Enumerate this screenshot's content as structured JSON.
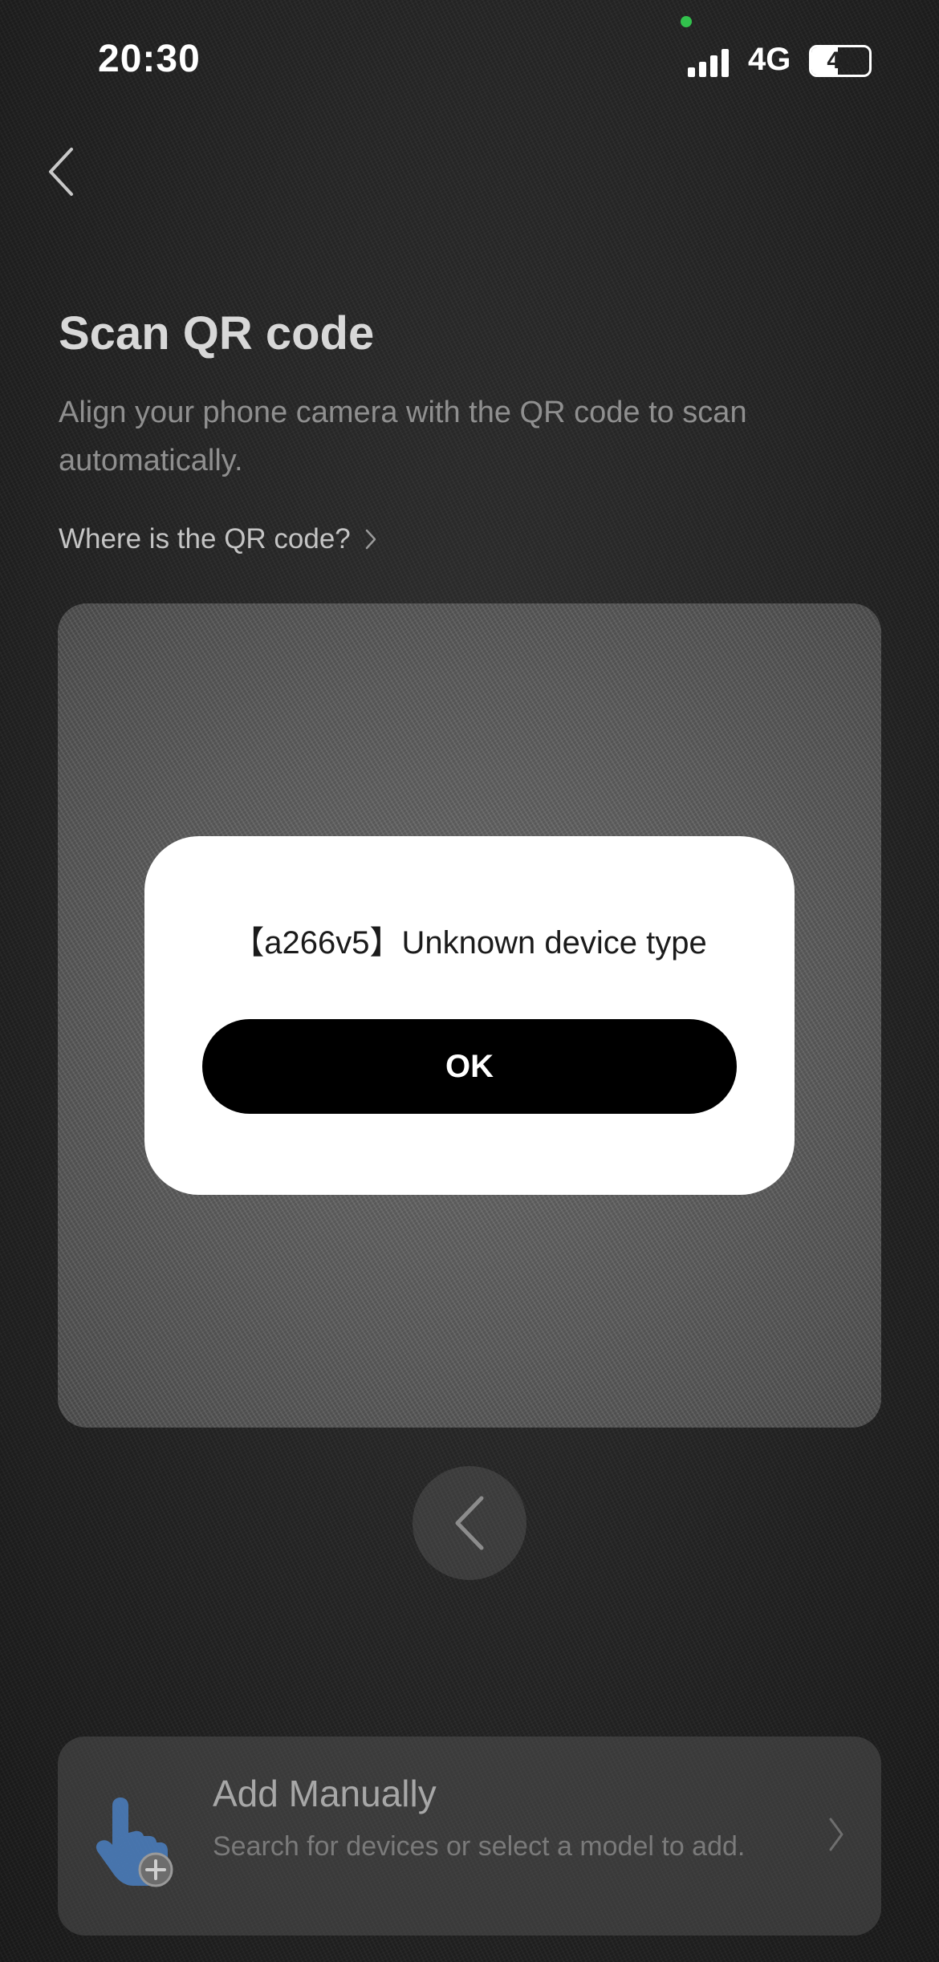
{
  "status_bar": {
    "time": "20:30",
    "network": "4G",
    "battery_level": "46"
  },
  "nav": {
    "back_icon": "chevron-left-icon"
  },
  "header": {
    "title": "Scan QR code",
    "subtitle": "Align your phone camera with the QR code to scan automatically.",
    "help_link": "Where is the QR code?"
  },
  "scanner": {
    "prev_icon": "chevron-left-icon"
  },
  "add_manually": {
    "title": "Add Manually",
    "description": "Search for devices or select a model to add.",
    "icon": "hand-tap-plus-icon"
  },
  "dialog": {
    "message": "【a266v5】Unknown device type",
    "ok_label": "OK"
  },
  "colors": {
    "privacy_dot": "#32c24d",
    "accent_icon": "#4a7fc1",
    "dialog_button": "#000000"
  }
}
